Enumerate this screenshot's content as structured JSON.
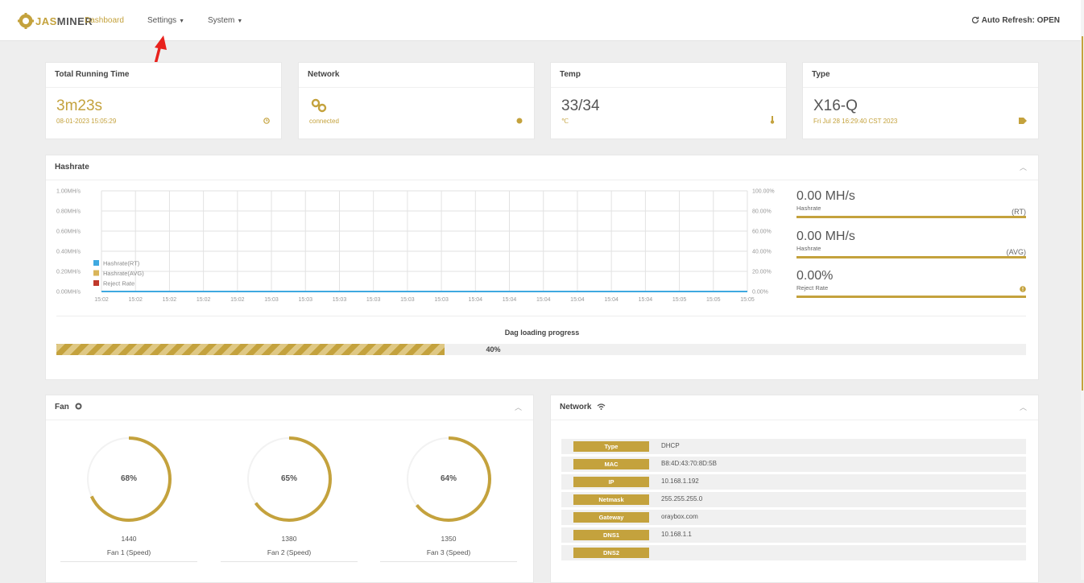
{
  "brand": {
    "prefix": "JAS",
    "name": "MINER"
  },
  "nav": {
    "dashboard": "Dashboard",
    "settings": "Settings",
    "system": "System"
  },
  "auto_refresh": "Auto Refresh: OPEN",
  "cards": {
    "running": {
      "title": "Total Running Time",
      "value": "3m23s",
      "sub": "08-01-2023 15:05:29"
    },
    "network": {
      "title": "Network",
      "sub": "connected"
    },
    "temp": {
      "title": "Temp",
      "value": "33/34",
      "sub": "℃"
    },
    "type": {
      "title": "Type",
      "value": "X16-Q",
      "sub": "Fri Jul 28 16:29:40 CST 2023"
    }
  },
  "hashrate": {
    "title": "Hashrate",
    "stats": [
      {
        "value": "0.00 MH/s",
        "label": "Hashrate",
        "tag": "(RT)"
      },
      {
        "value": "0.00 MH/s",
        "label": "Hashrate",
        "tag": "(AVG)"
      },
      {
        "value": "0.00%",
        "label": "Reject Rate"
      }
    ]
  },
  "chart_data": {
    "type": "line",
    "x": [
      "15:02",
      "15:02",
      "15:02",
      "15:02",
      "15:02",
      "15:03",
      "15:03",
      "15:03",
      "15:03",
      "15:03",
      "15:03",
      "15:04",
      "15:04",
      "15:04",
      "15:04",
      "15:04",
      "15:04",
      "15:05",
      "15:05",
      "15:05"
    ],
    "yticks_left": [
      "1.00MH/s",
      "0.80MH/s",
      "0.60MH/s",
      "0.40MH/s",
      "0.20MH/s",
      "0.00MH/s"
    ],
    "yticks_right": [
      "100.00%",
      "80.00%",
      "60.00%",
      "40.00%",
      "20.00%",
      "0.00%"
    ],
    "ylim": [
      0,
      1
    ],
    "series": [
      {
        "name": "Hashrate(RT)",
        "color": "#3fa9e0",
        "values": [
          0,
          0,
          0,
          0,
          0,
          0,
          0,
          0,
          0,
          0,
          0,
          0,
          0,
          0,
          0,
          0,
          0,
          0,
          0,
          0
        ]
      },
      {
        "name": "Hashrate(AVG)",
        "color": "#d9b55a",
        "values": [
          0,
          0,
          0,
          0,
          0,
          0,
          0,
          0,
          0,
          0,
          0,
          0,
          0,
          0,
          0,
          0,
          0,
          0,
          0,
          0
        ]
      },
      {
        "name": "Reject Rate",
        "color": "#c0392b",
        "values": [
          0,
          0,
          0,
          0,
          0,
          0,
          0,
          0,
          0,
          0,
          0,
          0,
          0,
          0,
          0,
          0,
          0,
          0,
          0,
          0
        ]
      }
    ],
    "grid": true,
    "legend": "bottom-left"
  },
  "dag": {
    "title": "Dag loading progress",
    "percent": 40,
    "label": "40%"
  },
  "fan": {
    "title": "Fan",
    "fans": [
      {
        "percent": 68,
        "label": "68%",
        "rpm": "1440",
        "name": "Fan 1 (Speed)"
      },
      {
        "percent": 65,
        "label": "65%",
        "rpm": "1380",
        "name": "Fan 2 (Speed)"
      },
      {
        "percent": 64,
        "label": "64%",
        "rpm": "1350",
        "name": "Fan 3 (Speed)"
      }
    ]
  },
  "network_panel": {
    "title": "Network",
    "rows": [
      {
        "key": "Type",
        "value": "DHCP"
      },
      {
        "key": "MAC",
        "value": "B8:4D:43:70:8D:5B"
      },
      {
        "key": "IP",
        "value": "10.168.1.192"
      },
      {
        "key": "Netmask",
        "value": "255.255.255.0"
      },
      {
        "key": "Gateway",
        "value": "oraybox.com"
      },
      {
        "key": "DNS1",
        "value": "10.168.1.1"
      },
      {
        "key": "DNS2",
        "value": ""
      }
    ]
  },
  "colors": {
    "accent": "#c4a23d",
    "reject": "#c0392b",
    "rt": "#3fa9e0"
  }
}
